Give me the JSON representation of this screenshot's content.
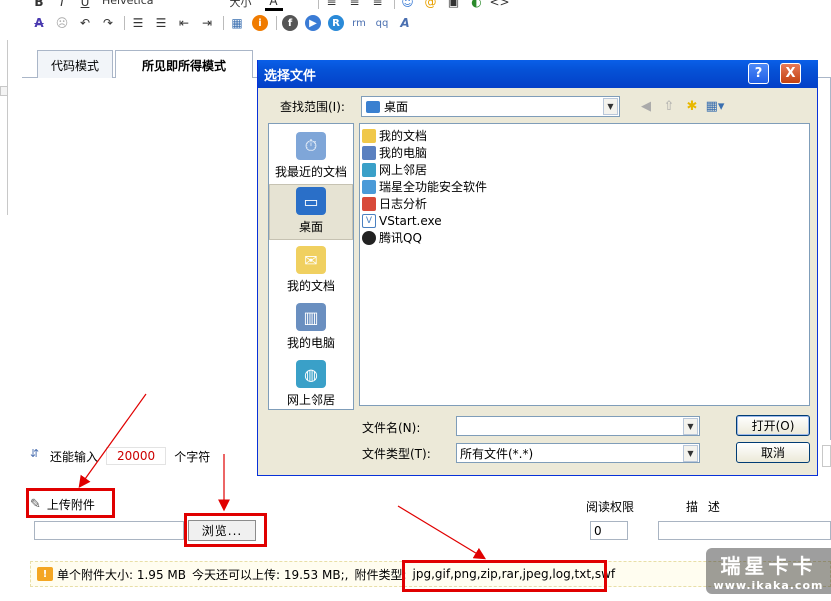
{
  "toolbar": {
    "font_name": "Helvetica",
    "font_size": "大小",
    "icons_row1": [
      "bold-icon",
      "italic-icon",
      "underline-icon",
      "font-color-icon",
      "align-left-icon",
      "align-center-icon",
      "align-right-icon",
      "emoticon-icon",
      "image-icon",
      "flash-icon",
      "source-icon"
    ],
    "icons_row2": [
      "strikethrough-icon",
      "smiley-icon",
      "undo-icon",
      "redo-icon",
      "ordered-list-icon",
      "unordered-list-icon",
      "outdent-icon",
      "indent-icon",
      "table-icon",
      "info-icon",
      "flash-insert-icon",
      "realplayer-icon",
      "media-icon",
      "wmv-icon",
      "qq-icon",
      "text-icon"
    ]
  },
  "tabs": {
    "code": "代码模式",
    "wysiwyg": "所见即所得模式"
  },
  "counter": {
    "prefix": "还能输入",
    "value": "20000",
    "suffix": "个字符"
  },
  "attachment": {
    "upload_label": "上传附件",
    "browse_label": "浏览...",
    "permission_label": "阅读权限",
    "permission_value": "0",
    "description_label": "描 述",
    "info_single_size": "单个附件大小: 1.95 MB",
    "info_today": "今天还可以上传: 19.53 MB;,",
    "info_types_label": "附件类型:",
    "info_types_value": "jpg,gif,png,zip,rar,jpeg,log,txt,swf"
  },
  "watermark": {
    "title": "瑞星卡卡",
    "url": "www.ikaka.com"
  },
  "dialog": {
    "title": "选择文件",
    "help_label": "?",
    "close_label": "X",
    "lookin_label": "查找范围(I):",
    "lookin_value": "桌面",
    "places": [
      "我最近的文档",
      "桌面",
      "我的文档",
      "我的电脑",
      "网上邻居"
    ],
    "files": [
      "我的文档",
      "我的电脑",
      "网上邻居",
      "瑞星全功能安全软件",
      "日志分析",
      "VStart.exe",
      "腾讯QQ"
    ],
    "filename_label": "文件名(N):",
    "filetype_label": "文件类型(T):",
    "filetype_value": "所有文件(*.*)",
    "open_label": "打开(O)",
    "cancel_label": "取消"
  },
  "colors": {
    "title_bar": "#0550d5",
    "highlight_red": "#e00000",
    "counter_red": "#cc0000"
  }
}
